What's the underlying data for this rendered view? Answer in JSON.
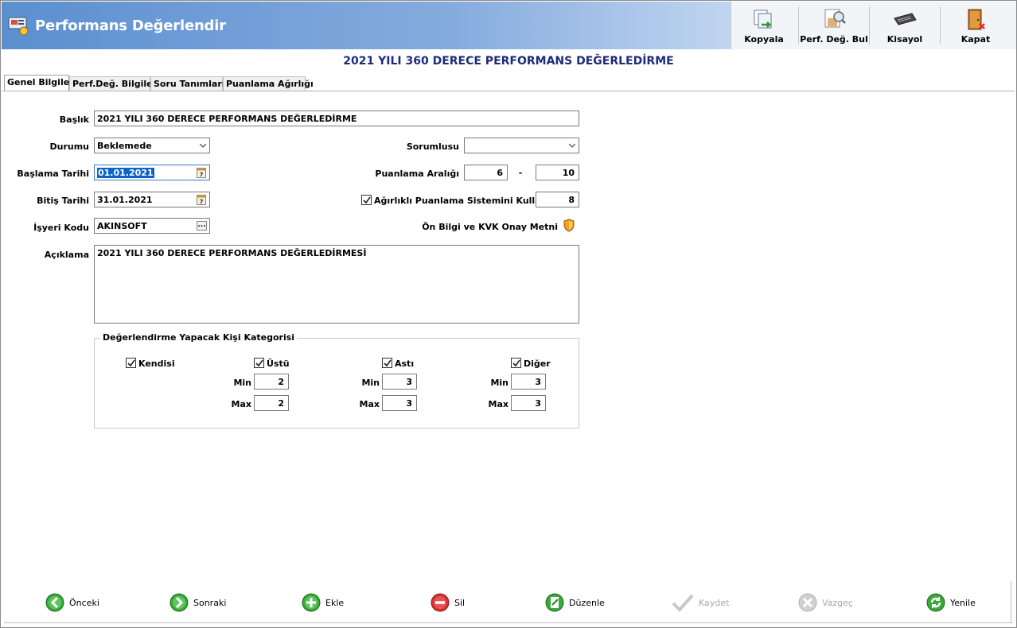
{
  "window": {
    "title": "Performans Değerlendir"
  },
  "toolbar": {
    "copy_label": "Kopyala",
    "find_label": "Perf. Değ. Bul",
    "shortcut_label": "Kisayol",
    "close_label": "Kapat"
  },
  "page_title": "2021 YILI 360 DERECE PERFORMANS DEĞERLEDİRME",
  "tabs": [
    {
      "label": "Genel Bilgiler",
      "active": true
    },
    {
      "label": "Perf.Değ. Bilgileri"
    },
    {
      "label": "Soru Tanımları"
    },
    {
      "label": "Puanlama Ağırlığı"
    }
  ],
  "form": {
    "baslik_label": "Başlık",
    "baslik_value": "2021 YILI 360 DERECE PERFORMANS DEĞERLEDİRME",
    "durumu_label": "Durumu",
    "durumu_value": "Beklemede",
    "sorumlusu_label": "Sorumlusu",
    "sorumlusu_value": "",
    "baslama_label": "Başlama Tarihi",
    "baslama_value": "01.01.2021",
    "puanlama_label": "Puanlama Aralığı",
    "puanlama_min": "6",
    "puanlama_dash": "-",
    "puanlama_max": "10",
    "bitis_label": "Bitiş Tarihi",
    "bitis_value": "31.01.2021",
    "agirlikli_label": "Ağırlıklı Puanlama Sistemini Kullan",
    "agirlikli_checked": true,
    "agirlikli_value": "8",
    "isyeri_label": "İşyeri Kodu",
    "isyeri_value": "AKINSOFT",
    "onbilgi_label": "Ön Bilgi ve KVK Onay Metni",
    "aciklama_label": "Açıklama",
    "aciklama_value": "2021 YILI 360 DERECE PERFORMANS DEĞERLEDİRMESİ"
  },
  "category_group": {
    "title": "Değerlendirme Yapacak Kişi Kategorisi",
    "min_label": "Min",
    "max_label": "Max",
    "kendisi": {
      "label": "Kendisi",
      "checked": true
    },
    "ustu": {
      "label": "Üstü",
      "checked": true,
      "min": "2",
      "max": "2"
    },
    "asti": {
      "label": "Astı",
      "checked": true,
      "min": "3",
      "max": "3"
    },
    "diger": {
      "label": "Diğer",
      "checked": true,
      "min": "3",
      "max": "3"
    }
  },
  "bottom_bar": {
    "onceki": "Önceki",
    "sonraki": "Sonraki",
    "ekle": "Ekle",
    "sil": "Sil",
    "duzenle": "Düzenle",
    "kaydet": "Kaydet",
    "vazgec": "Vazgeç",
    "yenile": "Yenile"
  },
  "colors": {
    "header_start": "#5b8fd0",
    "title_text": "#1e2a7a",
    "selection": "#0a64c8",
    "green_button": "#3aa83a",
    "red_button": "#d62f2f"
  }
}
